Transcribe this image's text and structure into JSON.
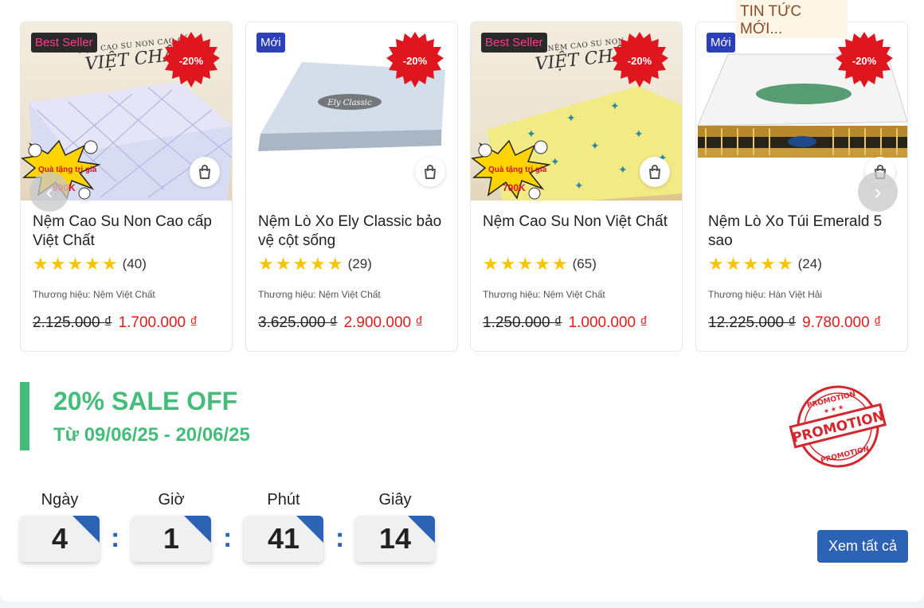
{
  "news_tab": "TIN TỨC MỚI...",
  "products": [
    {
      "badge": "Best Seller",
      "discount": "-20%",
      "name": "Nệm Cao Su Non Cao cấp Việt Chất",
      "stars": "★★★★★",
      "reviews": "(40)",
      "brand": "Thương hiệu: Nệm Việt Chất",
      "old_price": "2.125.000 ₫",
      "price": "1.700.000 ₫",
      "gift_line1": "Quà tặng trị giá",
      "gift_line2": "900K",
      "img_brand_small": "NỆM CAO SU NON CAO CẤP",
      "img_brand_big": "VIỆT CHẤT"
    },
    {
      "badge": "Mới",
      "discount": "-20%",
      "name": "Nệm Lò Xo Ely Classic bảo vệ cột sống",
      "stars": "★★★★★",
      "reviews": "(29)",
      "brand": "Thương hiệu: Nệm Việt Chất",
      "old_price": "3.625.000 ₫",
      "price": "2.900.000 ₫",
      "img_label": "Ely Classic"
    },
    {
      "badge": "Best Seller",
      "discount": "-20%",
      "name": "Nệm Cao Su Non Việt Chất",
      "stars": "★★★★★",
      "reviews": "(65)",
      "brand": "Thương hiệu: Nệm Việt Chất",
      "old_price": "1.250.000 ₫",
      "price": "1.000.000 ₫",
      "gift_line1": "Quà tặng trị giá",
      "gift_line2": "700K",
      "img_brand_small": "NỆM CAO SU NON",
      "img_brand_big": "VIỆT CHẤT"
    },
    {
      "badge": "Mới",
      "discount": "-20%",
      "name": "Nệm Lò Xo Túi Emerald 5 sao",
      "stars": "★★★★★",
      "reviews": "(24)",
      "brand": "Thương hiệu: Hàn Việt Hải",
      "old_price": "12.225.000 ₫",
      "price": "9.780.000 ₫"
    }
  ],
  "carousel": {
    "prev_icon": "‹",
    "next_icon": "›"
  },
  "promo": {
    "title": "20% SALE OFF",
    "dates": "Từ 09/06/25 - 20/06/25",
    "stamp_text": "PROMOTION",
    "accent_color": "#45bd7a"
  },
  "countdown": {
    "labels": [
      "Ngày",
      "Giờ",
      "Phút",
      "Giây"
    ],
    "values": [
      "4",
      "1",
      "41",
      "14"
    ],
    "separator": ":",
    "accent_color": "#2d63b5"
  },
  "see_all_label": "Xem tất cả"
}
